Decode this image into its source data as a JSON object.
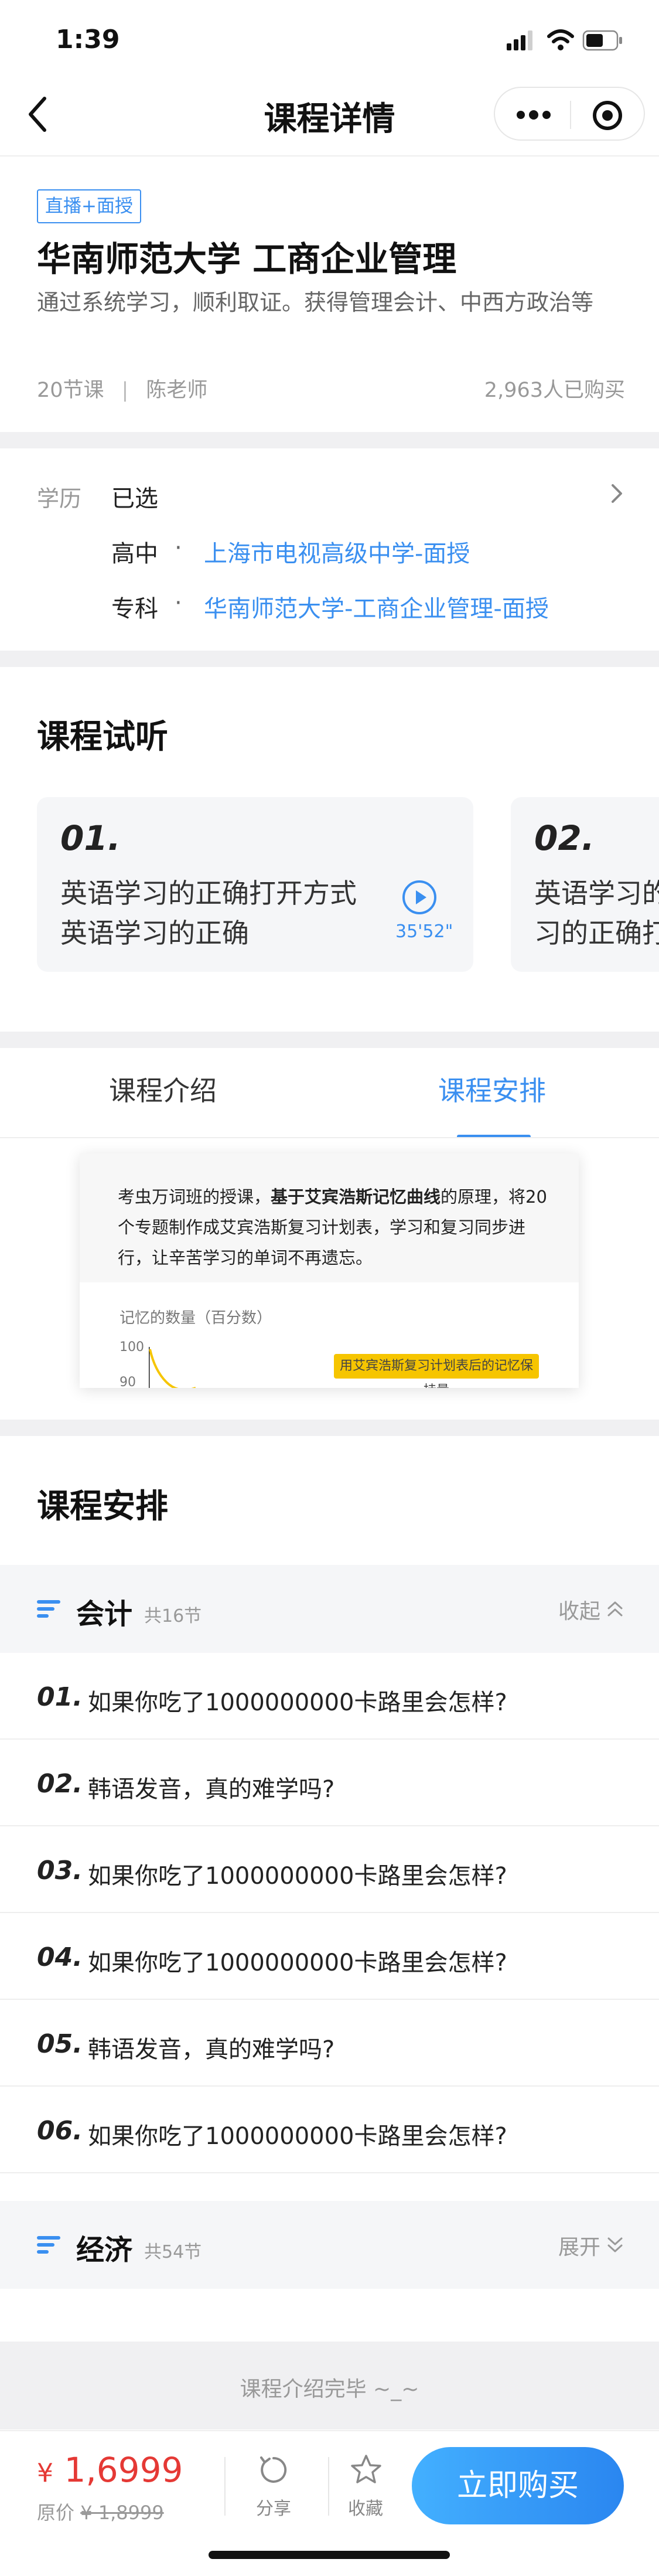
{
  "status_bar": {
    "time": "1:39"
  },
  "nav": {
    "title": "课程详情"
  },
  "course": {
    "tag": "直播+面授",
    "title": "华南师范大学 工商企业管理",
    "subtitle": "通过系统学习，顺利取证。获得管理会计、中西方政治等",
    "lessons_count": "20节课",
    "teacher": "陈老师",
    "purchased": "2,963人已购买"
  },
  "education": {
    "label": "学历",
    "value": "已选",
    "rows": [
      {
        "level": "高中",
        "dot": "·",
        "school": "上海市电视高级中学-面授"
      },
      {
        "level": "专科",
        "dot": "·",
        "school": "华南师范大学-工商企业管理-面授"
      }
    ]
  },
  "trial": {
    "title": "课程试听",
    "cards": [
      {
        "num": "01.",
        "line1": "英语学习的正确打开方式",
        "line2": "英语学习的正确",
        "duration": "35'52\""
      },
      {
        "num": "02.",
        "line1": "英语学习的",
        "line2": "习的正确打"
      }
    ]
  },
  "tabs": [
    {
      "label": "课程介绍",
      "active": false
    },
    {
      "label": "课程安排",
      "active": true
    }
  ],
  "intro_image": {
    "text_pre": "考虫万词班的授课，",
    "text_bold": "基于艾宾浩斯记忆曲线",
    "text_post": "的原理，将20个专题制作成艾宾浩斯复习计划表，学习和复习同步进行，让辛苦学习的单词不再遗忘。",
    "axis_label": "记忆的数量（百分数）",
    "y_top": "100",
    "y_second": "90",
    "badge": "用艾宾浩斯复习计划表后的记忆保持量"
  },
  "schedule": {
    "title": "课程安排",
    "groups": [
      {
        "name": "会计",
        "count": "共16节",
        "toggle": "收起",
        "expanded": true,
        "lessons": [
          {
            "num": "01.",
            "title": "如果你吃了1000000000卡路里会怎样?"
          },
          {
            "num": "02.",
            "title": "韩语发音，真的难学吗?"
          },
          {
            "num": "03.",
            "title": "如果你吃了1000000000卡路里会怎样?"
          },
          {
            "num": "04.",
            "title": "如果你吃了1000000000卡路里会怎样?"
          },
          {
            "num": "05.",
            "title": "韩语发音，真的难学吗?"
          },
          {
            "num": "06.",
            "title": "如果你吃了1000000000卡路里会怎样?"
          }
        ]
      },
      {
        "name": "经济",
        "count": "共54节",
        "toggle": "展开",
        "expanded": false
      }
    ]
  },
  "end_text": "课程介绍完毕 ~_~",
  "bottom_bar": {
    "currency": "¥",
    "price": "1,6999",
    "original_label": "原价",
    "original_price": "¥ 1,8999",
    "share_label": "分享",
    "favorite_label": "收藏",
    "buy_label": "立即购买"
  },
  "colors": {
    "accent": "#3a8ff0",
    "price": "#e53935",
    "badge": "#f6c500"
  }
}
